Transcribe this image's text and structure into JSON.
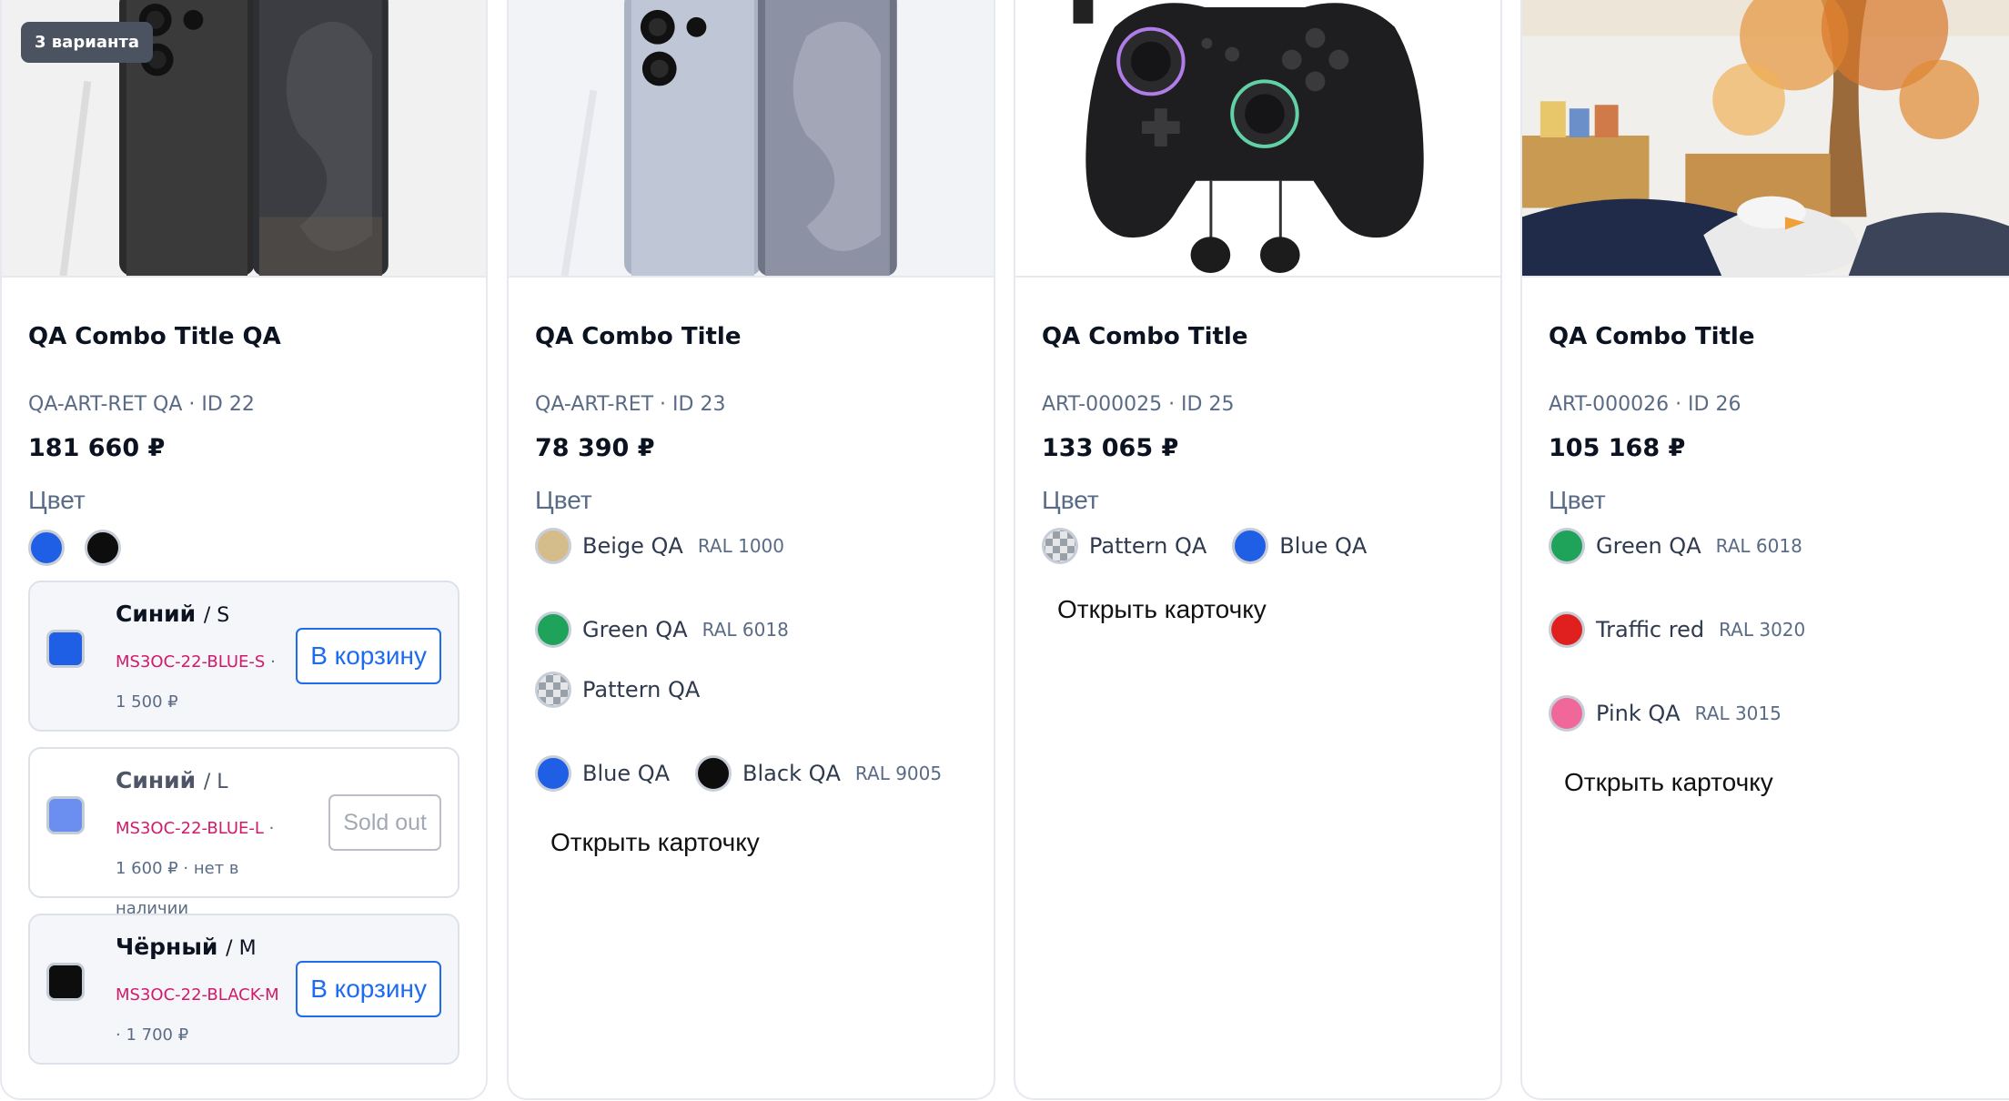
{
  "colors": {
    "blue": "#1f5fe6",
    "blue_light": "#6a8ff0",
    "black": "#0d0d0d",
    "beige": "#d4bd8a",
    "green": "#1fa25a",
    "red": "#e0201f",
    "pink": "#f0689a",
    "accent": "#1e6bf0"
  },
  "cards": [
    {
      "image_icon": "phone-product-image",
      "badge": "3 варианта",
      "title": "QA Combo Title QA",
      "sku": "QA-ART-RET QA · ID 22",
      "price": "181 660 ₽",
      "color_label": "Цвет",
      "dots": [
        "blue",
        "black"
      ],
      "variants": [
        {
          "color": "Синий",
          "size": "/ S",
          "sku": "MS3OC-22-BLUE-S",
          "meta_rest": " · 1 500 ₽",
          "button": "В корзину",
          "in_stock": true
        },
        {
          "color": "Синий",
          "size": "/ L",
          "sku": "MS3OC-22-BLUE-L",
          "meta_rest": " · 1 600 ₽ · нет в наличии",
          "button": "Sold out",
          "in_stock": false
        },
        {
          "color": "Чёрный",
          "size": "/ M",
          "sku": "MS3OC-22-BLACK-M",
          "meta_rest": " · 1 700 ₽",
          "button": "В корзину",
          "in_stock": true
        }
      ]
    },
    {
      "image_icon": "phone-product-image",
      "title": "QA Combo Title",
      "sku": "QA-ART-RET · ID 23",
      "price": "78 390 ₽",
      "color_label": "Цвет",
      "options": [
        {
          "name": "Beige QA",
          "code": "RAL 1000",
          "swatch": "beige"
        },
        {
          "name": "Green QA",
          "code": "RAL 6018",
          "swatch": "green"
        },
        {
          "name": "Pattern QA",
          "code": "",
          "swatch": "pattern"
        },
        {
          "name": "Blue QA",
          "code": "",
          "swatch": "blue"
        },
        {
          "name": "Black QA",
          "code": "RAL 9005",
          "swatch": "black"
        }
      ],
      "open_label": "Открыть карточку"
    },
    {
      "image_icon": "gamepad-product-image",
      "title": "QA Combo Title",
      "sku": "ART-000025 · ID 25",
      "price": "133 065 ₽",
      "color_label": "Цвет",
      "options": [
        {
          "name": "Pattern QA",
          "code": "",
          "swatch": "pattern"
        },
        {
          "name": "Blue QA",
          "code": "",
          "swatch": "blue"
        }
      ],
      "open_label": "Открыть карточку"
    },
    {
      "image_icon": "room-product-image",
      "title": "QA Combo Title",
      "sku": "ART-000026 · ID 26",
      "price": "105 168 ₽",
      "color_label": "Цвет",
      "options": [
        {
          "name": "Green QA",
          "code": "RAL 6018",
          "swatch": "green"
        },
        {
          "name": "Traffic red",
          "code": "RAL 3020",
          "swatch": "red"
        },
        {
          "name": "Pink QA",
          "code": "RAL 3015",
          "swatch": "pink"
        }
      ],
      "open_label": "Открыть карточку"
    }
  ]
}
